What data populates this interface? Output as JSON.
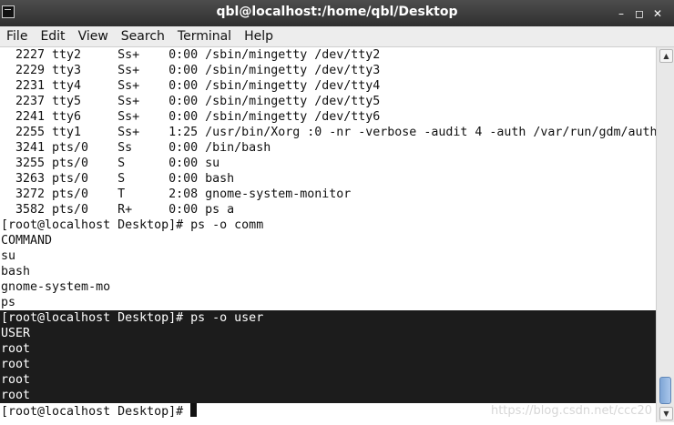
{
  "window": {
    "title": "qbl@localhost:/home/qbl/Desktop",
    "buttons": {
      "minimize": "–",
      "maximize": "◻",
      "close": "✕"
    }
  },
  "menu": [
    "File",
    "Edit",
    "View",
    "Search",
    "Terminal",
    "Help"
  ],
  "terminal": {
    "lines": [
      "  2227 tty2     Ss+    0:00 /sbin/mingetty /dev/tty2",
      "  2229 tty3     Ss+    0:00 /sbin/mingetty /dev/tty3",
      "  2231 tty4     Ss+    0:00 /sbin/mingetty /dev/tty4",
      "  2237 tty5     Ss+    0:00 /sbin/mingetty /dev/tty5",
      "  2241 tty6     Ss+    0:00 /sbin/mingetty /dev/tty6",
      "  2255 tty1     Ss+    1:25 /usr/bin/Xorg :0 -nr -verbose -audit 4 -auth /var/run/gdm/auth",
      "  3241 pts/0    Ss     0:00 /bin/bash",
      "  3255 pts/0    S      0:00 su",
      "  3263 pts/0    S      0:00 bash",
      "  3272 pts/0    T      2:08 gnome-system-monitor",
      "  3582 pts/0    R+     0:00 ps a",
      "[root@localhost Desktop]# ps -o comm",
      "COMMAND",
      "su",
      "bash",
      "gnome-system-mo",
      "ps",
      "[root@localhost Desktop]# ps -o user",
      "USER",
      "root",
      "root",
      "root",
      "root"
    ],
    "selected_from": 17,
    "prompt": "[root@localhost Desktop]# "
  },
  "watermark": "https://blog.csdn.net/ccc20",
  "scrollbar": {
    "up": "▲",
    "down": "▼"
  }
}
